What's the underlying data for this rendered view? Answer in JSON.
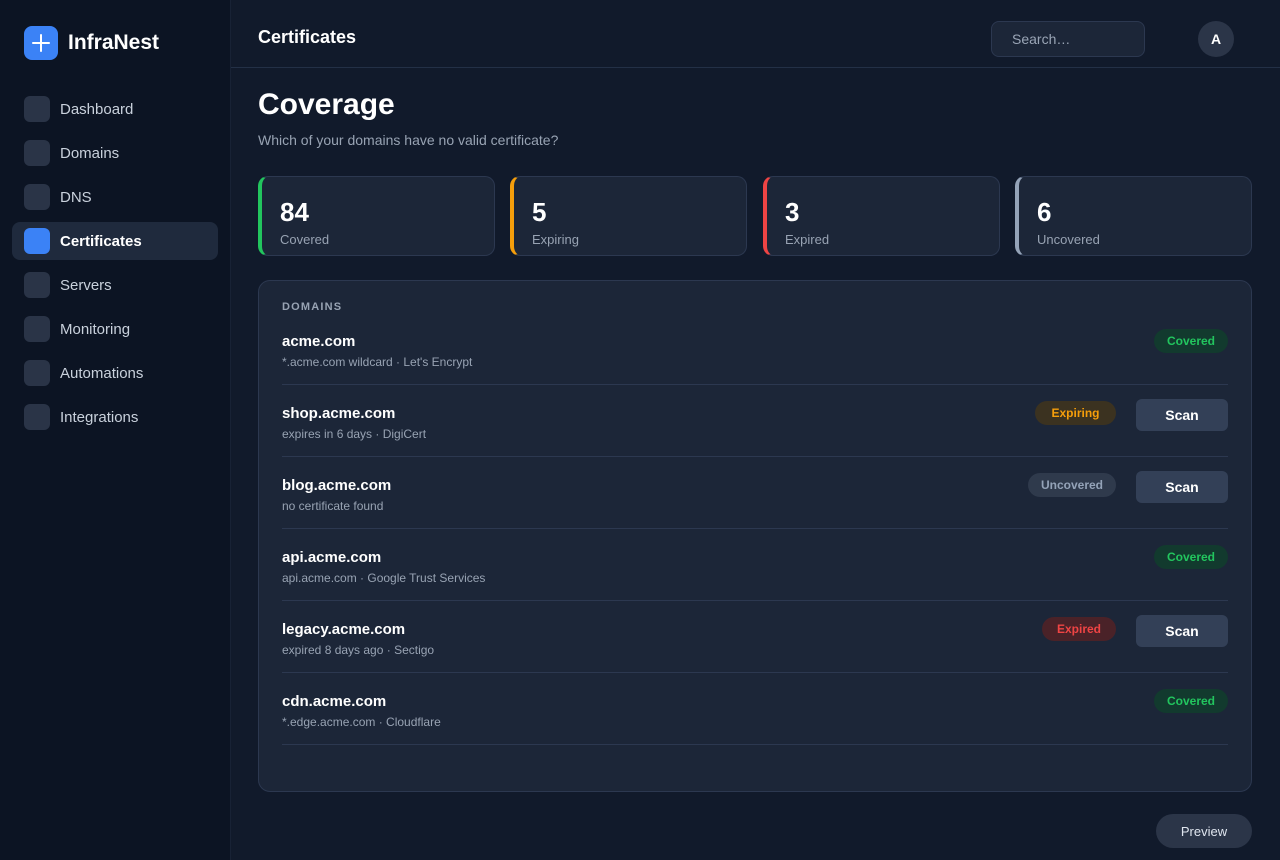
{
  "app": {
    "name": "InfraNest"
  },
  "sidebar": {
    "items": [
      {
        "label": "Dashboard",
        "active": false
      },
      {
        "label": "Domains",
        "active": false
      },
      {
        "label": "DNS",
        "active": false
      },
      {
        "label": "Certificates",
        "active": true
      },
      {
        "label": "Servers",
        "active": false
      },
      {
        "label": "Monitoring",
        "active": false
      },
      {
        "label": "Automations",
        "active": false
      },
      {
        "label": "Integrations",
        "active": false
      }
    ]
  },
  "header": {
    "title": "Certificates",
    "search_placeholder": "Search…",
    "avatar_initial": "A"
  },
  "page": {
    "heading": "Coverage",
    "subtitle": "Which of your domains have no valid certificate?"
  },
  "stats": [
    {
      "value": "84",
      "label": "Covered",
      "color": "#22c55e"
    },
    {
      "value": "5",
      "label": "Expiring",
      "color": "#f59e0b"
    },
    {
      "value": "3",
      "label": "Expired",
      "color": "#ef4444"
    },
    {
      "value": "6",
      "label": "Uncovered",
      "color": "#94a3b8"
    }
  ],
  "domains_panel": {
    "label": "DOMAINS",
    "rows": [
      {
        "name": "acme.com",
        "meta": "*.acme.com wildcard · Let's Encrypt",
        "status": "Covered",
        "scan": ""
      },
      {
        "name": "shop.acme.com",
        "meta": "expires in 6 days · DigiCert",
        "status": "Expiring",
        "scan": "Scan"
      },
      {
        "name": "blog.acme.com",
        "meta": "no certificate found",
        "status": "Uncovered",
        "scan": "Scan"
      },
      {
        "name": "api.acme.com",
        "meta": "api.acme.com · Google Trust Services",
        "status": "Covered",
        "scan": ""
      },
      {
        "name": "legacy.acme.com",
        "meta": "expired 8 days ago · Sectigo",
        "status": "Expired",
        "scan": "Scan"
      },
      {
        "name": "cdn.acme.com",
        "meta": "*.edge.acme.com · Cloudflare",
        "status": "Covered",
        "scan": ""
      }
    ]
  },
  "status_styles": {
    "Covered": {
      "text": "#22c55e",
      "bg": "#123a2e"
    },
    "Expiring": {
      "text": "#f59e0b",
      "bg": "#3b3220"
    },
    "Uncovered": {
      "text": "#94a3b8",
      "bg": "#2f3a4c"
    },
    "Expired": {
      "text": "#ef4444",
      "bg": "#4a2228"
    }
  },
  "footer": {
    "preview_label": "Preview"
  }
}
